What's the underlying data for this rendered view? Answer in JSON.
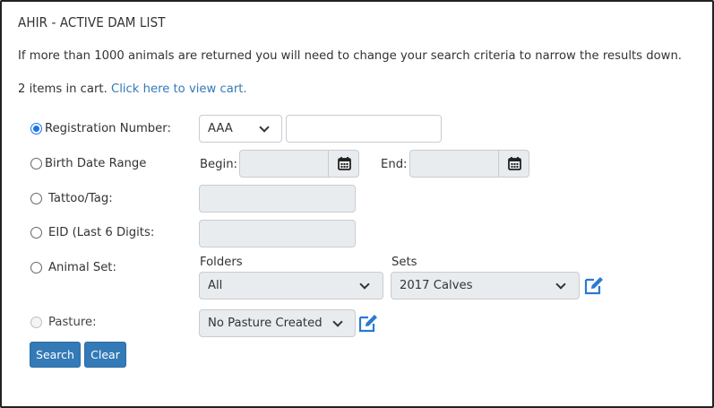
{
  "page": {
    "title": "AHIR - ACTIVE DAM LIST",
    "info_text": "If more than 1000 animals are returned you will need to change your search criteria to narrow the results down.",
    "cart_text": "2 items in cart.",
    "cart_link": "Click here to view cart."
  },
  "form": {
    "registration": {
      "label": "Registration Number:",
      "breed": "AAA",
      "value": ""
    },
    "birth_date": {
      "label": "Birth Date Range",
      "begin_label": "Begin:",
      "end_label": "End:",
      "begin_value": "",
      "end_value": ""
    },
    "tattoo": {
      "label": "Tattoo/Tag:",
      "value": ""
    },
    "eid": {
      "label": "EID (Last 6 Digits:",
      "value": ""
    },
    "animal_set": {
      "label": "Animal Set:",
      "folders_label": "Folders",
      "folders_value": "All",
      "sets_label": "Sets",
      "sets_value": "2017 Calves"
    },
    "pasture": {
      "label": "Pasture:",
      "value": "No Pasture Created"
    }
  },
  "buttons": {
    "search": "Search",
    "clear": "Clear"
  },
  "colors": {
    "accent": "#337ab7",
    "radio_checked": "#1a73e8",
    "input_disabled": "#e9ecef",
    "border": "#222222"
  },
  "icons": [
    "radio-icon",
    "calendar-icon",
    "chevron-down-icon",
    "edit-icon"
  ]
}
